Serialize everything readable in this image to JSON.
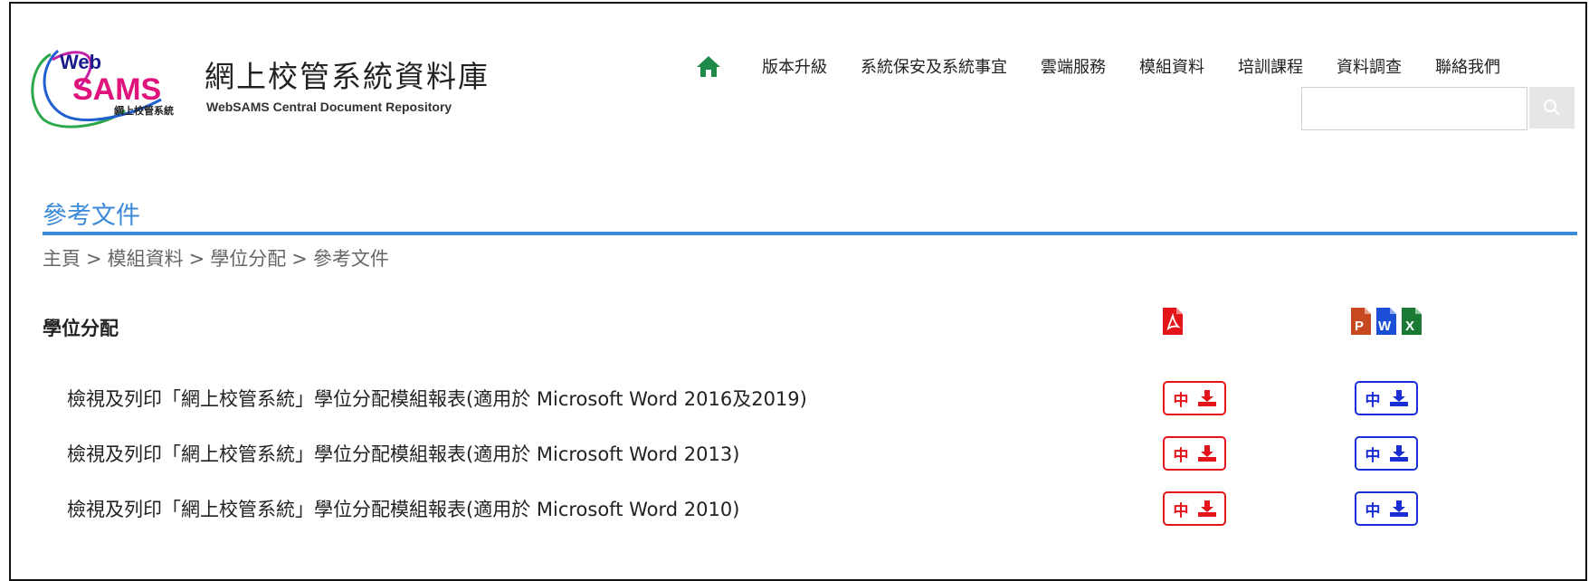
{
  "header": {
    "logo_alt": "WebSAMS",
    "logo_word_top": "Web",
    "logo_word_bottom": "SAMS",
    "logo_cn_small": "網上校管系統",
    "site_title": "網上校管系統資料庫",
    "site_subtitle": "WebSAMS Central Document Repository"
  },
  "nav": {
    "home_icon": "home-icon",
    "items": [
      {
        "label": "版本升級"
      },
      {
        "label": "系統保安及系統事宜"
      },
      {
        "label": "雲端服務"
      },
      {
        "label": "模組資料"
      },
      {
        "label": "培訓課程"
      },
      {
        "label": "資料調查"
      },
      {
        "label": "聯絡我們"
      }
    ],
    "search_placeholder": "",
    "search_icon": "search-icon"
  },
  "page": {
    "title": "參考文件",
    "breadcrumb": [
      "主頁",
      "模組資料",
      "學位分配",
      "參考文件"
    ],
    "breadcrumb_sep": ">"
  },
  "section": {
    "title": "學位分配",
    "pdf_icon": "pdf-file-icon",
    "office_icons": [
      "powerpoint-file-icon",
      "word-file-icon",
      "excel-file-icon"
    ],
    "docs": [
      {
        "title": "檢視及列印「網上校管系統」學位分配模組報表(適用於 Microsoft Word 2016及2019)",
        "pdf_lang": "中",
        "office_lang": "中"
      },
      {
        "title": "檢視及列印「網上校管系統」學位分配模組報表(適用於 Microsoft Word 2013)",
        "pdf_lang": "中",
        "office_lang": "中"
      },
      {
        "title": "檢視及列印「網上校管系統」學位分配模組報表(適用於 Microsoft Word 2010)",
        "pdf_lang": "中",
        "office_lang": "中"
      }
    ]
  },
  "colors": {
    "accent": "#3b8ad9",
    "pdf_red": "#e3151a",
    "office_blue": "#1b2ed6",
    "home_green": "#1e8a4a"
  }
}
